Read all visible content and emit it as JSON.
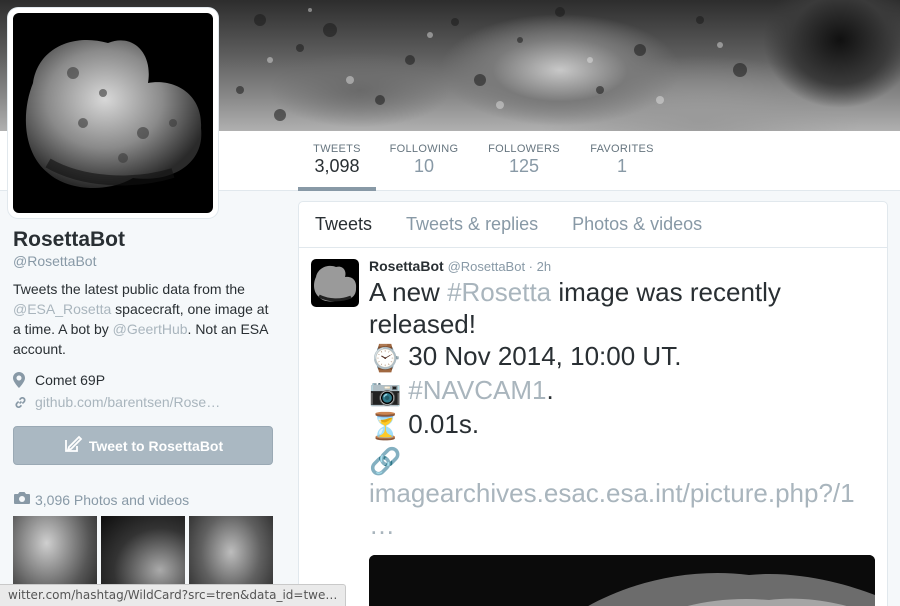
{
  "profile": {
    "name": "RosettaBot",
    "handle": "@RosettaBot",
    "bio": {
      "t1": "Tweets the latest public data from the ",
      "link1": "@ESA_Rosetta",
      "t2": " spacecraft, one image at a time. A bot by ",
      "link2": "@GeertHub",
      "t3": ". Not an ESA account."
    },
    "location": "Comet 69P",
    "website": "github.com/barentsen/Rose…",
    "tweet_to_label": "Tweet to RosettaBot",
    "photos_label": "3,096 Photos and videos"
  },
  "stats": [
    {
      "label": "TWEETS",
      "value": "3,098"
    },
    {
      "label": "FOLLOWING",
      "value": "10"
    },
    {
      "label": "FOLLOWERS",
      "value": "125"
    },
    {
      "label": "FAVORITES",
      "value": "1"
    }
  ],
  "tabs": [
    "Tweets",
    "Tweets & replies",
    "Photos & videos"
  ],
  "tweet": {
    "name": "RosettaBot",
    "meta": "@RosettaBot · 2h",
    "l1a": "A new ",
    "l1tag": "#Rosetta",
    "l1b": " image was recently released!",
    "l2emoji": "⌚",
    "l2": "30 Nov 2014, 10:00 UT.",
    "l3emoji": "📷",
    "l3tag": "#NAVCAM1",
    "l3b": ".",
    "l4emoji": "⏳",
    "l4": "0.01s.",
    "l5emoji": "🔗",
    "l5link": "imagearchives.esac.esa.int/picture.php?/1",
    "l6": "…"
  },
  "statusbar": "witter.com/hashtag/WildCard?src=tren&data_id=twe…",
  "colors": {
    "link": "#a9b5bd",
    "muted": "#8899a6",
    "button": "#aab8c2"
  }
}
